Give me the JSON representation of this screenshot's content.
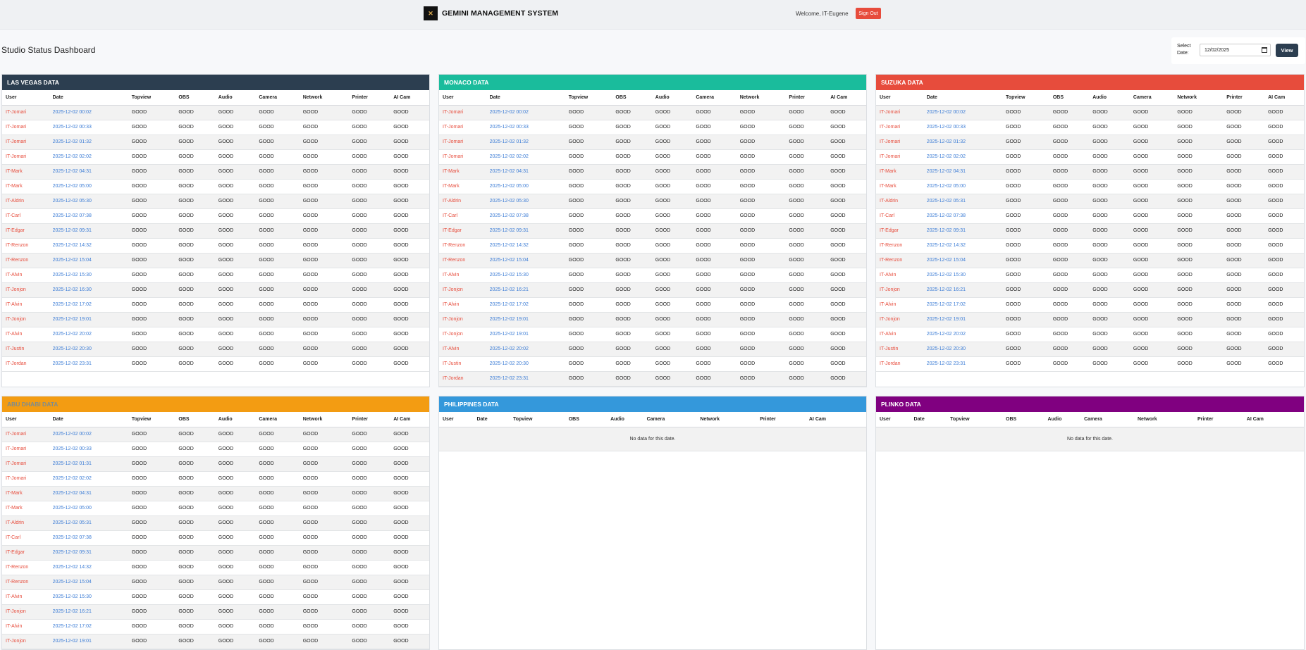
{
  "header": {
    "logo_icon": "gemini-logo",
    "title": "GEMINI MANAGEMENT SYSTEM",
    "welcome": "Welcome, IT-Eugene",
    "sign_out": "Sign Out"
  },
  "page": {
    "title": "Studio Status Dashboard",
    "date_label": "Select Date:",
    "date_value": "12/02/2025",
    "view_button": "View"
  },
  "columns": [
    "User",
    "Date",
    "Topview",
    "OBS",
    "Audio",
    "Camera",
    "Network",
    "Printer",
    "AI Cam"
  ],
  "status": "GOOD",
  "no_data": "No data for this date.",
  "panels": [
    {
      "title": "LAS VEGAS DATA",
      "color": "#2c3e50",
      "title_color": "#ffffff",
      "rows": [
        [
          "IT-Jomari",
          "2025-12-02 00:02"
        ],
        [
          "IT-Jomari",
          "2025-12-02 00:33"
        ],
        [
          "IT-Jomari",
          "2025-12-02 01:32"
        ],
        [
          "IT-Jomari",
          "2025-12-02 02:02"
        ],
        [
          "IT-Mark",
          "2025-12-02 04:31"
        ],
        [
          "IT-Mark",
          "2025-12-02 05:00"
        ],
        [
          "IT-Aldrin",
          "2025-12-02 05:30"
        ],
        [
          "IT-Carl",
          "2025-12-02 07:38"
        ],
        [
          "IT-Edgar",
          "2025-12-02 09:31"
        ],
        [
          "IT-Renzon",
          "2025-12-02 14:32"
        ],
        [
          "IT-Renzon",
          "2025-12-02 15:04"
        ],
        [
          "IT-Alvin",
          "2025-12-02 15:30"
        ],
        [
          "IT-Jonjon",
          "2025-12-02 16:30"
        ],
        [
          "IT-Alvin",
          "2025-12-02 17:02"
        ],
        [
          "IT-Jonjon",
          "2025-12-02 19:01"
        ],
        [
          "IT-Alvin",
          "2025-12-02 20:02"
        ],
        [
          "IT-Justin",
          "2025-12-02 20:30"
        ],
        [
          "IT-Jordan",
          "2025-12-02 23:31"
        ]
      ]
    },
    {
      "title": "MONACO DATA",
      "color": "#1abc9c",
      "title_color": "#ffffff",
      "rows": [
        [
          "IT-Jomari",
          "2025-12-02 00:02"
        ],
        [
          "IT-Jomari",
          "2025-12-02 00:33"
        ],
        [
          "IT-Jomari",
          "2025-12-02 01:32"
        ],
        [
          "IT-Jomari",
          "2025-12-02 02:02"
        ],
        [
          "IT-Mark",
          "2025-12-02 04:31"
        ],
        [
          "IT-Mark",
          "2025-12-02 05:00"
        ],
        [
          "IT-Aldrin",
          "2025-12-02 05:30"
        ],
        [
          "IT-Carl",
          "2025-12-02 07:38"
        ],
        [
          "IT-Edgar",
          "2025-12-02 09:31"
        ],
        [
          "IT-Renzon",
          "2025-12-02 14:32"
        ],
        [
          "IT-Renzon",
          "2025-12-02 15:04"
        ],
        [
          "IT-Alvin",
          "2025-12-02 15:30"
        ],
        [
          "IT-Jonjon",
          "2025-12-02 16:21"
        ],
        [
          "IT-Alvin",
          "2025-12-02 17:02"
        ],
        [
          "IT-Jonjon",
          "2025-12-02 19:01"
        ],
        [
          "IT-Jonjon",
          "2025-12-02 19:01"
        ],
        [
          "IT-Alvin",
          "2025-12-02 20:02"
        ],
        [
          "IT-Justin",
          "2025-12-02 20:30"
        ],
        [
          "IT-Jordan",
          "2025-12-02 23:31"
        ]
      ]
    },
    {
      "title": "SUZUKA DATA",
      "color": "#e74c3c",
      "title_color": "#ffffff",
      "rows": [
        [
          "IT-Jomari",
          "2025-12-02 00:02"
        ],
        [
          "IT-Jomari",
          "2025-12-02 00:33"
        ],
        [
          "IT-Jomari",
          "2025-12-02 01:32"
        ],
        [
          "IT-Jomari",
          "2025-12-02 02:02"
        ],
        [
          "IT-Mark",
          "2025-12-02 04:31"
        ],
        [
          "IT-Mark",
          "2025-12-02 05:00"
        ],
        [
          "IT-Aldrin",
          "2025-12-02 05:31"
        ],
        [
          "IT-Carl",
          "2025-12-02 07:38"
        ],
        [
          "IT-Edgar",
          "2025-12-02 09:31"
        ],
        [
          "IT-Renzon",
          "2025-12-02 14:32"
        ],
        [
          "IT-Renzon",
          "2025-12-02 15:04"
        ],
        [
          "IT-Alvin",
          "2025-12-02 15:30"
        ],
        [
          "IT-Jonjon",
          "2025-12-02 16:21"
        ],
        [
          "IT-Alvin",
          "2025-12-02 17:02"
        ],
        [
          "IT-Jonjon",
          "2025-12-02 19:01"
        ],
        [
          "IT-Alvin",
          "2025-12-02 20:02"
        ],
        [
          "IT-Justin",
          "2025-12-02 20:30"
        ],
        [
          "IT-Jordan",
          "2025-12-02 23:31"
        ]
      ]
    },
    {
      "title": "ABU DHABI DATA",
      "color": "#f39c12",
      "title_color": "#7f8c8d",
      "rows": [
        [
          "IT-Jomari",
          "2025-12-02 00:02"
        ],
        [
          "IT-Jomari",
          "2025-12-02 00:33"
        ],
        [
          "IT-Jomari",
          "2025-12-02 01:31"
        ],
        [
          "IT-Jomari",
          "2025-12-02 02:02"
        ],
        [
          "IT-Mark",
          "2025-12-02 04:31"
        ],
        [
          "IT-Mark",
          "2025-12-02 05:00"
        ],
        [
          "IT-Aldrin",
          "2025-12-02 05:31"
        ],
        [
          "IT-Carl",
          "2025-12-02 07:38"
        ],
        [
          "IT-Edgar",
          "2025-12-02 09:31"
        ],
        [
          "IT-Renzon",
          "2025-12-02 14:32"
        ],
        [
          "IT-Renzon",
          "2025-12-02 15:04"
        ],
        [
          "IT-Alvin",
          "2025-12-02 15:30"
        ],
        [
          "IT-Jonjon",
          "2025-12-02 16:21"
        ],
        [
          "IT-Alvin",
          "2025-12-02 17:02"
        ],
        [
          "IT-Jonjon",
          "2025-12-02 19:01"
        ]
      ]
    },
    {
      "title": "PHILIPPINES DATA",
      "color": "#3498db",
      "title_color": "#ffffff",
      "rows": []
    },
    {
      "title": "PLINKO DATA",
      "color": "#800080",
      "title_color": "#ffffff",
      "rows": []
    }
  ]
}
